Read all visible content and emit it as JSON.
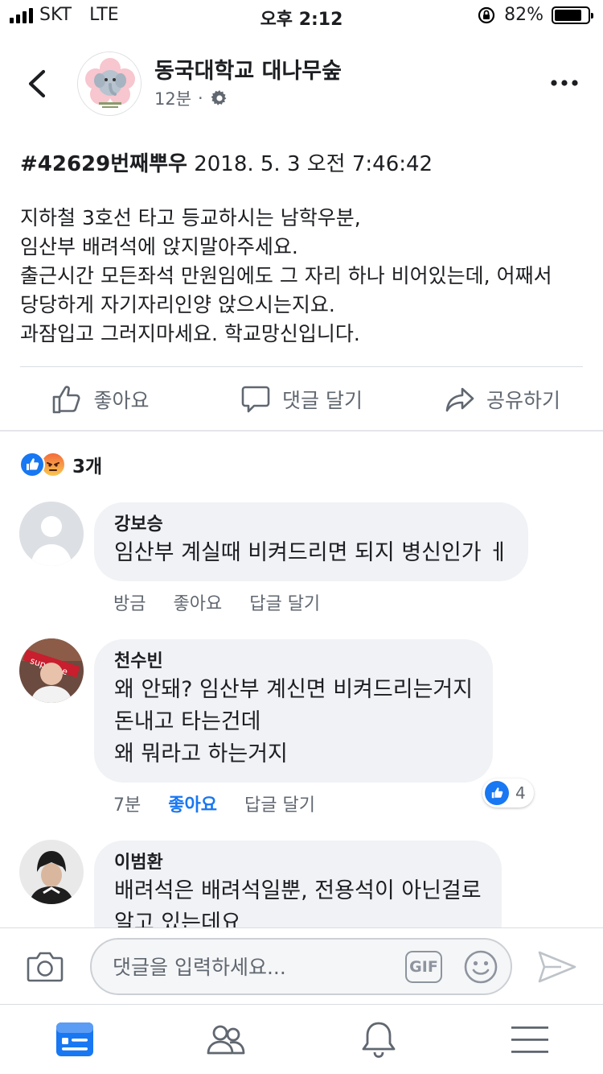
{
  "status_bar": {
    "carrier": "SKT",
    "network": "LTE",
    "time": "오후 2:12",
    "battery": "82%",
    "battery_level": 0.82
  },
  "post": {
    "page_name": "동국대학교 대나무숲",
    "time_ago": "12분",
    "separator": "·",
    "title_tag": "#42629번째뿌우",
    "title_date": "2018. 5. 3 오전 7:46:42",
    "body_lines": [
      "지하철 3호선 타고 등교하시는 남학우분,",
      "임산부 배려석에 앉지말아주세요.",
      "출근시간 모든좌석 만원임에도 그 자리 하나 비어있는데, 어째서",
      "당당하게 자기자리인양 앉으시는지요.",
      "과잠입고 그러지마세요. 학교망신입니다."
    ]
  },
  "actions": {
    "like": "좋아요",
    "comment": "댓글 달기",
    "share": "공유하기"
  },
  "reactions": {
    "count": "3개",
    "types": [
      "like",
      "angry"
    ]
  },
  "comments": [
    {
      "name": "강보승",
      "lines": [
        "임산부 계실때 비켜드리면 되지 병신인가 ㅔ"
      ],
      "time": "방금",
      "like_label": "좋아요",
      "reply_label": "답글 달기",
      "liked": false,
      "likes": ""
    },
    {
      "name": "천수빈",
      "lines": [
        "왜 안돼? 임산부 계신면 비켜드리는거지",
        "돈내고 타는건데",
        "왜 뭐라고 하는거지"
      ],
      "time": "7분",
      "like_label": "좋아요",
      "reply_label": "답글 달기",
      "liked": true,
      "likes": "4"
    },
    {
      "name": "이범환",
      "lines": [
        "배려석은 배려석일뿐, 전용석이 아닌걸로",
        "알고 있는데요"
      ],
      "time": "",
      "like_label": "",
      "reply_label": "",
      "liked": false,
      "likes": ""
    }
  ],
  "composer": {
    "placeholder": "댓글을 입력하세요...",
    "gif_label": "GIF"
  },
  "tab_bar": {
    "tabs": [
      "news-feed",
      "friends",
      "notifications",
      "menu"
    ],
    "active": "news-feed"
  },
  "colors": {
    "accent": "#1877f2",
    "secondary_text": "#606770",
    "bubble": "#f0f2f5",
    "angry": "#f5a623"
  }
}
